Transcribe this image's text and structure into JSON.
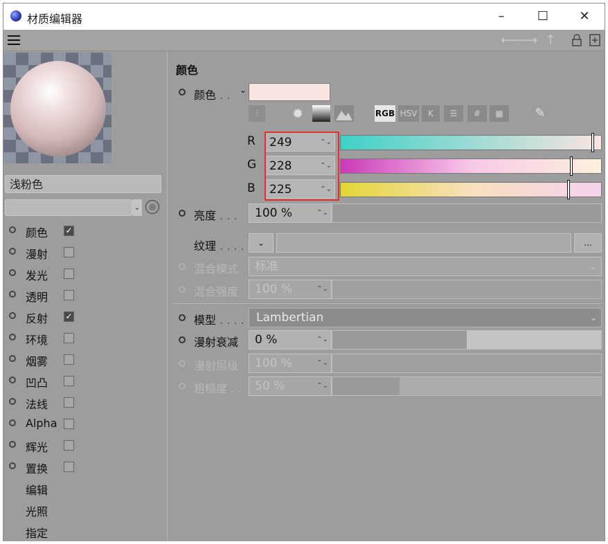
{
  "window": {
    "title": "材质编辑器",
    "minimize": "–",
    "maximize": "☐",
    "close": "✕"
  },
  "menubar": {
    "icons": [
      "menu-icon",
      "back-arrow-icon",
      "forward-arrow-icon",
      "up-arrow-icon",
      "lock-icon",
      "new-window-icon"
    ]
  },
  "left": {
    "material_name": "浅粉色",
    "channels": [
      {
        "label": "颜色",
        "checked": true
      },
      {
        "label": "漫射",
        "checked": false
      },
      {
        "label": "发光",
        "checked": false
      },
      {
        "label": "透明",
        "checked": false
      },
      {
        "label": "反射",
        "checked": true
      },
      {
        "label": "环境",
        "checked": false
      },
      {
        "label": "烟雾",
        "checked": false
      },
      {
        "label": "凹凸",
        "checked": false
      },
      {
        "label": "法线",
        "checked": false
      },
      {
        "label": "Alpha",
        "checked": false
      },
      {
        "label": "辉光",
        "checked": false
      },
      {
        "label": "置换",
        "checked": false
      }
    ],
    "extra": [
      "编辑",
      "光照",
      "指定"
    ]
  },
  "right": {
    "section_title": "颜色",
    "color_label": "颜色",
    "swatch_color": "#f9e4e1",
    "tool_labels": {
      "rgb": "RGB",
      "hsv": "HSV",
      "k": "K",
      "hash": "#"
    },
    "rgb": [
      {
        "channel": "R",
        "value": "249"
      },
      {
        "channel": "G",
        "value": "228"
      },
      {
        "channel": "B",
        "value": "225"
      }
    ],
    "brightness": {
      "label": "亮度",
      "value": "100 %"
    },
    "texture": {
      "label": "纹理",
      "more": "..."
    },
    "blend_mode": {
      "label": "混合模式",
      "value": "标准"
    },
    "blend_strength": {
      "label": "混合强度",
      "value": "100 %"
    },
    "model": {
      "label": "模型",
      "value": "Lambertian"
    },
    "diffuse_falloff": {
      "label": "漫射衰减",
      "value": "0 %",
      "level": 0.5
    },
    "diffuse_level": {
      "label": "漫射层级",
      "value": "100 %"
    },
    "roughness": {
      "label": "粗糙度",
      "value": "50 %",
      "level": 0.25
    }
  }
}
